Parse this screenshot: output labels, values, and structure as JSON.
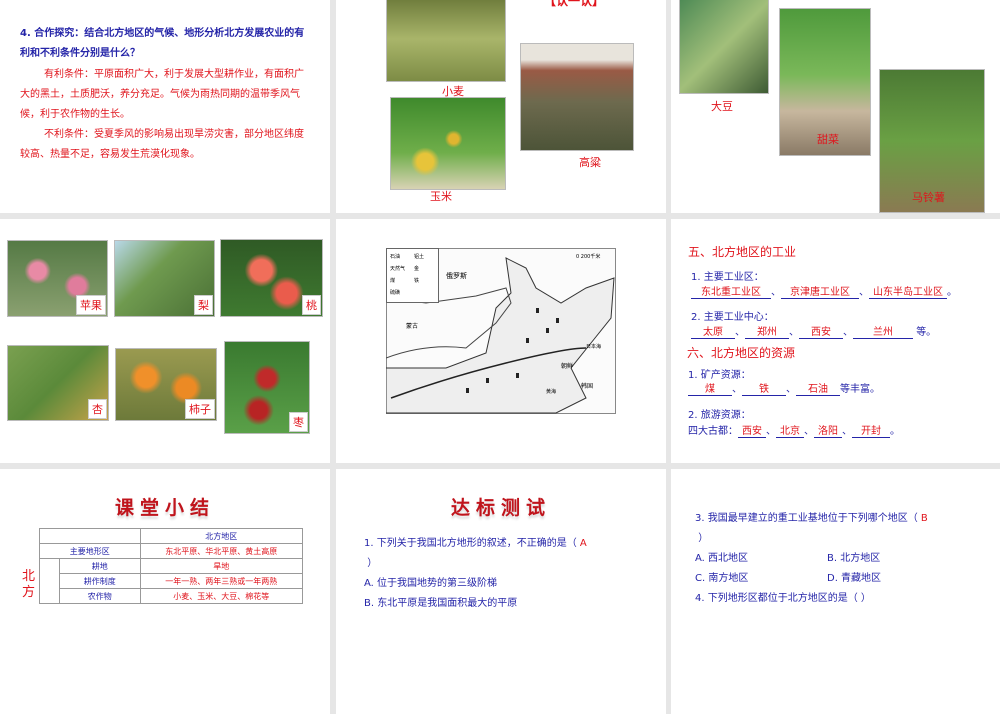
{
  "slides": [
    {
      "question": "4. 合作探究：结合北方地区的气候、地形分析北方发展农业的有利和不利条件分别是什么？",
      "favorable": "有利条件：平原面积广大，利于发展大型耕作业，有面积广大的黑土，土质肥沃，养分充足。气候为雨热同期的温带季风气候，利于农作物的生长。",
      "unfavorable": "不利条件：受夏季风的影响易出现旱涝灾害，部分地区纬度较高、热量不足，容易发生荒漠化现象。"
    },
    {
      "title": "【认一认】",
      "crops": [
        "小麦",
        "高粱",
        "玉米"
      ]
    },
    {
      "crops": [
        "大豆",
        "甜菜",
        "马铃薯"
      ]
    },
    {
      "fruits": [
        "苹果",
        "梨",
        "桃",
        "杏",
        "柿子",
        "枣"
      ]
    },
    {
      "map": {
        "legend": [
          "石油",
          "铝土",
          "天然气",
          "金",
          "煤",
          "铁",
          "硫磺"
        ],
        "scale": "0  200千米",
        "labels": [
          "俄罗斯",
          "蒙古",
          "朝鲜",
          "韩国",
          "黄海",
          "日本海"
        ]
      }
    },
    {
      "h1": "五、北方地区的工业",
      "q1": "1. 主要工业区：",
      "zones": [
        "东北重工业区",
        "京津唐工业区",
        "山东半岛工业区"
      ],
      "q2": "2. 主要工业中心：",
      "centers": [
        "太原",
        "郑州",
        "西安",
        "兰州"
      ],
      "deng": "等。",
      "h2": "六、北方地区的资源",
      "q3": "1. 矿产资源：",
      "minerals": [
        "煤",
        "铁",
        "石油"
      ],
      "fengfu": "等丰富。",
      "q4": "2. 旅游资源：",
      "capitals_label": "四大古都：",
      "capitals": [
        "西安",
        "北京",
        "洛阳",
        "开封"
      ],
      "sep": "、",
      "end": "。"
    },
    {
      "title": "课堂小结",
      "table": {
        "header": "北方地区",
        "side": "北方",
        "rows": [
          [
            "主要地形区",
            "东北平原、华北平原、黄土高原"
          ],
          [
            "耕地",
            "旱地"
          ],
          [
            "耕作制度",
            "一年一熟、两年三熟或一年两熟"
          ],
          [
            "农作物",
            "小麦、玉米、大豆、棉花等"
          ]
        ]
      }
    },
    {
      "title": "达标测试",
      "q1": "1. 下列关于我国北方地形的叙述，不正确的是（",
      "a1": "A",
      "close": "）",
      "optA": "A. 位于我国地势的第三级阶梯",
      "optB": "B. 东北平原是我国面积最大的平原"
    },
    {
      "q3": "3. 我国最早建立的重工业基地位于下列哪个地区（",
      "a3": "B",
      "close": "）",
      "opts": [
        "A. 西北地区",
        "B. 北方地区",
        "C. 南方地区",
        "D. 青藏地区"
      ],
      "q4": "4. 下列地形区都位于北方地区的是（          ）"
    }
  ]
}
